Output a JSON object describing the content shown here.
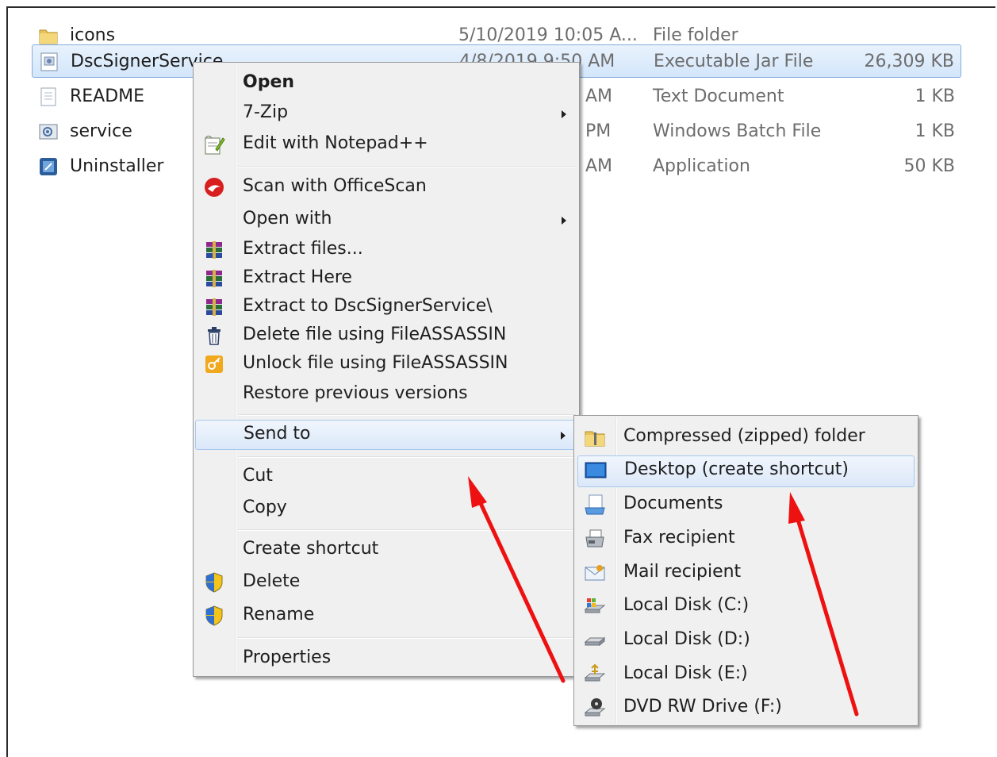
{
  "files": [
    {
      "name": "icons",
      "date": "5/10/2019 10:05 A...",
      "type": "File folder",
      "size": "",
      "icon": "folder-icon"
    },
    {
      "name": "DscSignerService",
      "date": "4/8/2019 9:50 AM",
      "type": "Executable Jar File",
      "size": "26,309 KB",
      "icon": "jar-file-icon",
      "selected": true
    },
    {
      "name": "README",
      "date": "AM",
      "type": "Text Document",
      "size": "1 KB",
      "icon": "text-file-icon"
    },
    {
      "name": "service",
      "date": "PM",
      "type": "Windows Batch File",
      "size": "1 KB",
      "icon": "batch-file-icon"
    },
    {
      "name": "Uninstaller",
      "date": "AM",
      "type": "Application",
      "size": "50 KB",
      "icon": "application-icon"
    }
  ],
  "context_menu": {
    "items": [
      {
        "label": "Open",
        "bold": true
      },
      {
        "label": "7-Zip",
        "submenu": true
      },
      {
        "label": "Edit with Notepad++",
        "icon": "notepad-plus-plus-icon"
      },
      {
        "label": "Scan with OfficeScan",
        "icon": "officescan-icon"
      },
      {
        "label": "Open with",
        "submenu": true
      },
      {
        "label": "Extract files...",
        "icon": "winrar-icon"
      },
      {
        "label": "Extract Here",
        "icon": "winrar-icon"
      },
      {
        "label": "Extract to DscSignerService\\",
        "icon": "winrar-icon"
      },
      {
        "label": "Delete file using FileASSASSIN",
        "icon": "trash-icon"
      },
      {
        "label": "Unlock file using FileASSASSIN",
        "icon": "key-icon"
      },
      {
        "label": "Restore previous versions"
      },
      {
        "label": "Send to",
        "submenu": true,
        "highlighted": true
      },
      {
        "label": "Cut"
      },
      {
        "label": "Copy"
      },
      {
        "label": "Create shortcut"
      },
      {
        "label": "Delete",
        "icon": "uac-shield-icon"
      },
      {
        "label": "Rename",
        "icon": "uac-shield-icon"
      },
      {
        "label": "Properties"
      }
    ]
  },
  "send_to_menu": {
    "items": [
      {
        "label": "Compressed (zipped) folder",
        "icon": "zip-folder-icon"
      },
      {
        "label": "Desktop (create shortcut)",
        "icon": "desktop-icon",
        "highlighted": true
      },
      {
        "label": "Documents",
        "icon": "documents-icon"
      },
      {
        "label": "Fax recipient",
        "icon": "fax-icon"
      },
      {
        "label": "Mail recipient",
        "icon": "mail-icon"
      },
      {
        "label": "Local Disk (C:)",
        "icon": "system-disk-icon"
      },
      {
        "label": "Local Disk (D:)",
        "icon": "disk-icon"
      },
      {
        "label": "Local Disk (E:)",
        "icon": "usb-disk-icon"
      },
      {
        "label": "DVD RW Drive (F:)",
        "icon": "dvd-drive-icon"
      }
    ]
  },
  "colors": {
    "annotation_arrow": "#ee1111",
    "selection": "#cce4f9",
    "menu_background": "#f0f0f0"
  }
}
